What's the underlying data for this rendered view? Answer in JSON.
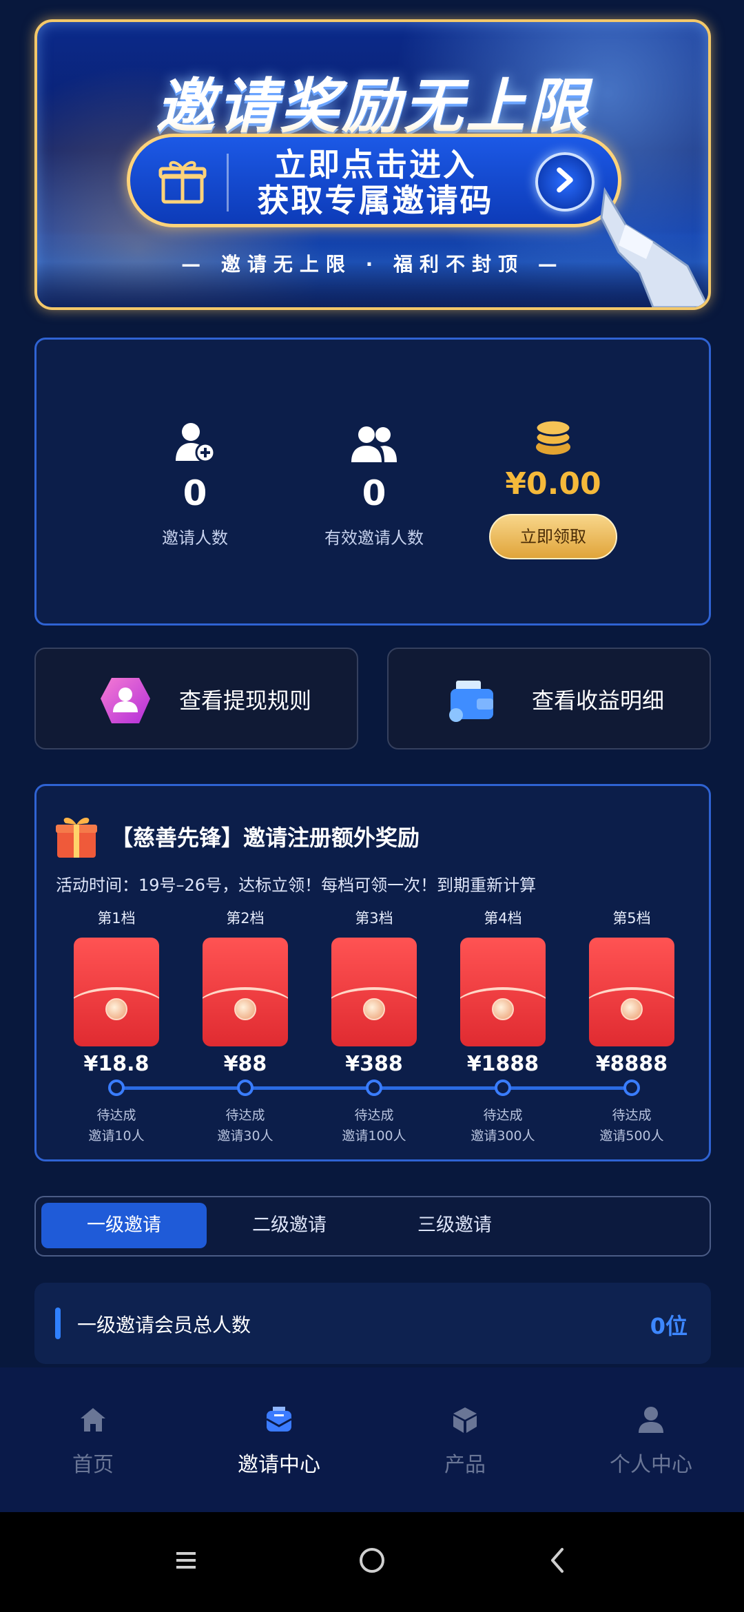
{
  "banner": {
    "title": "邀请奖励无上限",
    "cta_line1": "立即点击进入",
    "cta_line2": "获取专属邀请码",
    "subtitle": "— 邀请无上限 · 福利不封顶 —"
  },
  "stats": {
    "invites": {
      "value": "0",
      "label": "邀请人数",
      "icon": "user-add-icon"
    },
    "valid_invites": {
      "value": "0",
      "label": "有效邀请人数",
      "icon": "users-icon"
    },
    "earnings": {
      "value": "¥0.00",
      "button": "立即领取",
      "icon": "coins-icon"
    }
  },
  "actions": {
    "withdraw_rules": "查看提现规则",
    "earnings_detail": "查看收益明细"
  },
  "reward": {
    "title": "【慈善先锋】邀请注册额外奖励",
    "time": "活动时间：19号–26号，达标立领！每档可领一次！到期重新计算",
    "tiers": [
      {
        "label": "第1档",
        "amount": "¥18.8",
        "status": "待达成",
        "requirement": "邀请10人"
      },
      {
        "label": "第2档",
        "amount": "¥88",
        "status": "待达成",
        "requirement": "邀请30人"
      },
      {
        "label": "第3档",
        "amount": "¥388",
        "status": "待达成",
        "requirement": "邀请100人"
      },
      {
        "label": "第4档",
        "amount": "¥1888",
        "status": "待达成",
        "requirement": "邀请300人"
      },
      {
        "label": "第5档",
        "amount": "¥8888",
        "status": "待达成",
        "requirement": "邀请500人"
      }
    ]
  },
  "tabs": [
    "一级邀请",
    "二级邀请",
    "三级邀请"
  ],
  "active_tab": "一级邀请",
  "summary": {
    "label": "一级邀请会员总人数",
    "count": "0位"
  },
  "nav": [
    {
      "label": "首页",
      "icon": "home-icon"
    },
    {
      "label": "邀请中心",
      "icon": "invite-icon"
    },
    {
      "label": "产品",
      "icon": "box-icon"
    },
    {
      "label": "个人中心",
      "icon": "profile-icon"
    }
  ],
  "colors": {
    "accent": "#1f5bd8",
    "gold": "#f5b93a",
    "background": "#08183d"
  }
}
